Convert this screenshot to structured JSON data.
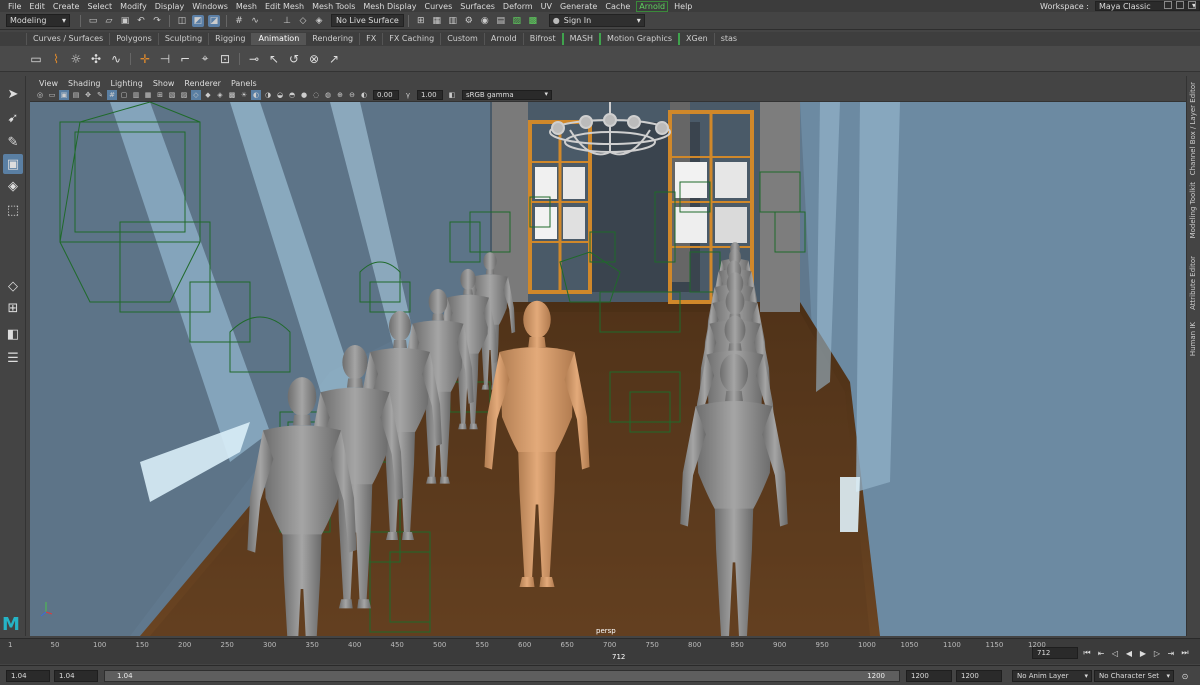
{
  "menu": {
    "items": [
      "File",
      "Edit",
      "Create",
      "Select",
      "Modify",
      "Display",
      "Windows",
      "Mesh",
      "Edit Mesh",
      "Mesh Tools",
      "Mesh Display",
      "Curves",
      "Surfaces",
      "Deform",
      "UV",
      "Generate",
      "Cache",
      "Arnold",
      "Help"
    ],
    "workspace_label": "Workspace :",
    "workspace_value": "Maya Classic"
  },
  "status": {
    "mode": "Modeling",
    "live_surface": "No Live Surface",
    "sign_in": "Sign In"
  },
  "shelf": {
    "tabs": [
      "Curves / Surfaces",
      "Polygons",
      "Sculpting",
      "Rigging",
      "Animation",
      "Rendering",
      "FX",
      "FX Caching",
      "Custom",
      "Arnold",
      "Bifrost",
      "MASH",
      "Motion Graphics",
      "XGen",
      "stas"
    ],
    "active_tab": "Animation"
  },
  "panel": {
    "menu": [
      "View",
      "Shading",
      "Lighting",
      "Show",
      "Renderer",
      "Panels"
    ],
    "exposure": "0.00",
    "gamma": "1.00",
    "color_space": "sRGB gamma",
    "camera": "persp"
  },
  "side_panels": [
    "Channel Box / Layer Editor",
    "Modeling Toolkit",
    "Attribute Editor",
    "Human IK"
  ],
  "timeline": {
    "ticks": [
      "1",
      "50",
      "100",
      "150",
      "200",
      "250",
      "300",
      "350",
      "400",
      "450",
      "500",
      "550",
      "600",
      "650",
      "700",
      "750",
      "800",
      "850",
      "900",
      "950",
      "1000",
      "1050",
      "1100",
      "1150",
      "1200"
    ],
    "current_frame": "712",
    "current_frame_field": "712"
  },
  "range": {
    "start": "1.04",
    "playback_start": "1.04",
    "slider_start": "1.04",
    "slider_end": "1200",
    "playback_end": "1200",
    "end": "1200",
    "anim_layer": "No Anim Layer",
    "character_set": "No Character Set"
  },
  "colors": {
    "accent": "#5a7fa3",
    "arnold_green": "#5fd35f",
    "floor": "#5a3a1e",
    "wall": "#6e8aa0"
  }
}
